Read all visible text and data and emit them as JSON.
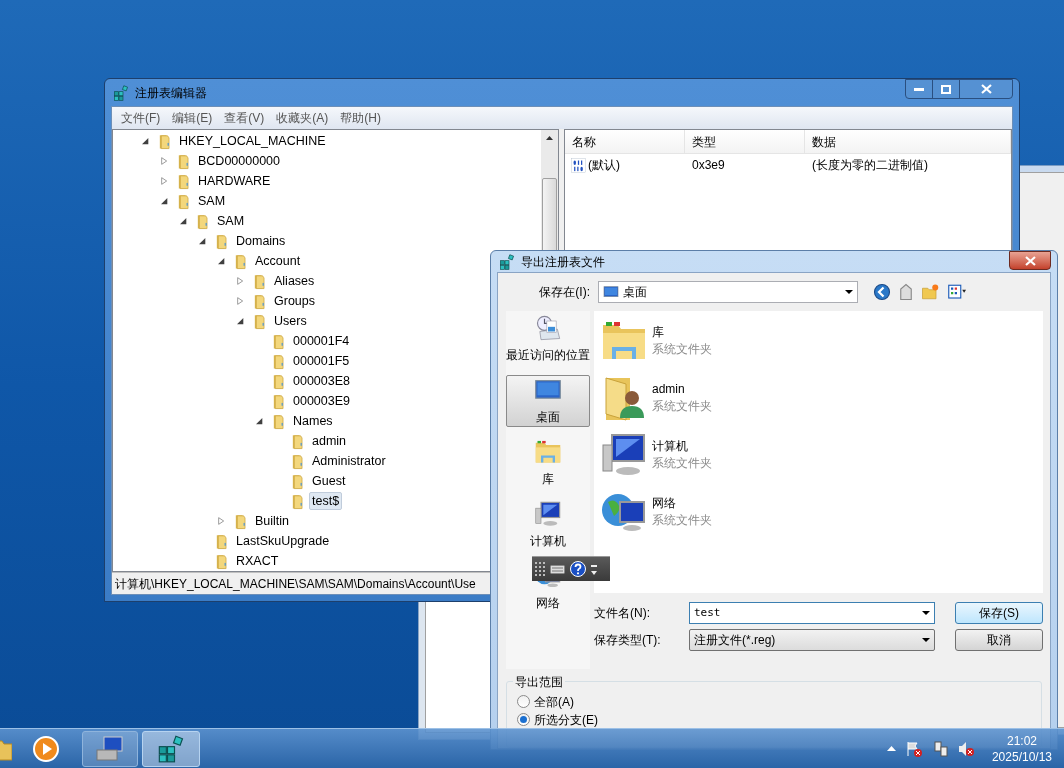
{
  "regedit": {
    "title": "注册表编辑器",
    "menu": [
      "文件(F)",
      "编辑(E)",
      "查看(V)",
      "收藏夹(A)",
      "帮助(H)"
    ],
    "tree": [
      {
        "label": "HKEY_LOCAL_MACHINE",
        "expanded": true,
        "selected": false,
        "children": [
          {
            "label": "BCD00000000",
            "expanded": false,
            "selected": false
          },
          {
            "label": "HARDWARE",
            "expanded": false,
            "selected": false
          },
          {
            "label": "SAM",
            "expanded": true,
            "selected": false,
            "children": [
              {
                "label": "SAM",
                "expanded": true,
                "selected": false,
                "children": [
                  {
                    "label": "Domains",
                    "expanded": true,
                    "selected": false,
                    "children": [
                      {
                        "label": "Account",
                        "expanded": true,
                        "selected": false,
                        "children": [
                          {
                            "label": "Aliases",
                            "expanded": false,
                            "selected": false
                          },
                          {
                            "label": "Groups",
                            "expanded": false,
                            "selected": false
                          },
                          {
                            "label": "Users",
                            "expanded": true,
                            "selected": false,
                            "children": [
                              {
                                "label": "000001F4",
                                "selected": false
                              },
                              {
                                "label": "000001F5",
                                "selected": false
                              },
                              {
                                "label": "000003E8",
                                "selected": false
                              },
                              {
                                "label": "000003E9",
                                "selected": false
                              },
                              {
                                "label": "Names",
                                "expanded": true,
                                "selected": false,
                                "children": [
                                  {
                                    "label": "admin",
                                    "selected": false
                                  },
                                  {
                                    "label": "Administrator",
                                    "selected": false
                                  },
                                  {
                                    "label": "Guest",
                                    "selected": false
                                  },
                                  {
                                    "label": "test$",
                                    "selected": true
                                  }
                                ]
                              }
                            ]
                          }
                        ]
                      },
                      {
                        "label": "Builtin",
                        "expanded": false,
                        "selected": false
                      }
                    ]
                  },
                  {
                    "label": "LastSkuUpgrade",
                    "selected": false
                  },
                  {
                    "label": "RXACT",
                    "selected": false
                  }
                ]
              }
            ]
          }
        ]
      }
    ],
    "values_table": {
      "columns": [
        "名称",
        "类型",
        "数据"
      ],
      "rows": [
        {
          "name": "(默认)",
          "type": "0x3e9",
          "data": "(长度为零的二进制值)"
        }
      ]
    },
    "status_bar": "计算机\\HKEY_LOCAL_MACHINE\\SAM\\SAM\\Domains\\Account\\Use"
  },
  "export_dialog": {
    "title": "导出注册表文件",
    "save_in_label": "保存在(I):",
    "save_in_value": "桌面",
    "places": [
      {
        "label": "最近访问的位置",
        "kind": "recent",
        "selected": false
      },
      {
        "label": "桌面",
        "kind": "desktop",
        "selected": true
      },
      {
        "label": "库",
        "kind": "library",
        "selected": false
      },
      {
        "label": "计算机",
        "kind": "computer",
        "selected": false
      },
      {
        "label": "网络",
        "kind": "network",
        "selected": false
      }
    ],
    "files": [
      {
        "name": "库",
        "description": "系统文件夹",
        "kind": "library"
      },
      {
        "name": "admin",
        "description": "系统文件夹",
        "kind": "user"
      },
      {
        "name": "计算机",
        "description": "系统文件夹",
        "kind": "computer"
      },
      {
        "name": "网络",
        "description": "系统文件夹",
        "kind": "network"
      }
    ],
    "filename_label": "文件名(N):",
    "filename_value": "test",
    "filetype_label": "保存类型(T):",
    "filetype_value": "注册文件(*.reg)",
    "buttons": [
      "保存(S)",
      "取消"
    ],
    "export_range": {
      "title": "导出范围",
      "options": [
        {
          "label": "全部(A)",
          "selected": false
        },
        {
          "label": "所选分支(E)",
          "selected": true
        }
      ]
    }
  },
  "taskbar": {
    "time": "21:02",
    "date": "2025/10/13"
  }
}
